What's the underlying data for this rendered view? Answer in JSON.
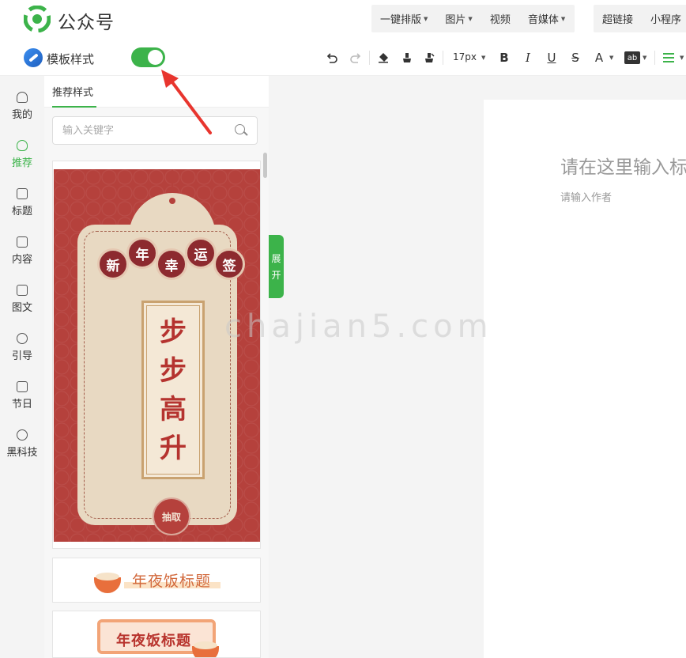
{
  "header": {
    "app_title": "公众号",
    "menu_group1": [
      {
        "label": "一键排版",
        "has_caret": true
      },
      {
        "label": "图片",
        "has_caret": true
      },
      {
        "label": "视频",
        "has_caret": false
      },
      {
        "label": "音媒体",
        "has_caret": true
      }
    ],
    "menu_group2": [
      {
        "label": "超链接"
      },
      {
        "label": "小程序"
      }
    ]
  },
  "toolbar": {
    "template_label": "模板样式",
    "template_toggle_on": true,
    "font_size": "17px",
    "bold": "B",
    "italic": "I",
    "underline": "U",
    "strike": "S",
    "font_color": "A",
    "highlight": "ab"
  },
  "rail": {
    "items": [
      {
        "label": "我的",
        "icon": "person-icon"
      },
      {
        "label": "推荐",
        "icon": "bulb-icon",
        "active": true
      },
      {
        "label": "标题",
        "icon": "title-icon"
      },
      {
        "label": "内容",
        "icon": "content-icon"
      },
      {
        "label": "图文",
        "icon": "image-text-icon"
      },
      {
        "label": "引导",
        "icon": "guide-icon"
      },
      {
        "label": "节日",
        "icon": "calendar-icon"
      },
      {
        "label": "黑科技",
        "icon": "tech-icon"
      }
    ]
  },
  "panel": {
    "tab": "推荐样式",
    "search_placeholder": "输入关键字",
    "expand_label_1": "展",
    "expand_label_2": "开",
    "card1": {
      "coins": [
        "新",
        "年",
        "幸",
        "运",
        "签"
      ],
      "main_chars": [
        "步",
        "步",
        "高",
        "升"
      ],
      "button": "抽取"
    },
    "card2_title": "年夜饭标题",
    "card3_title": "年夜饭标题"
  },
  "editor": {
    "title_placeholder": "请在这里输入标",
    "author_placeholder": "请输入作者"
  },
  "watermark": "chajian5.com",
  "colors": {
    "accent": "#3cb34a",
    "poster_red": "#b5413c",
    "annotation_arrow": "#e8352e"
  }
}
